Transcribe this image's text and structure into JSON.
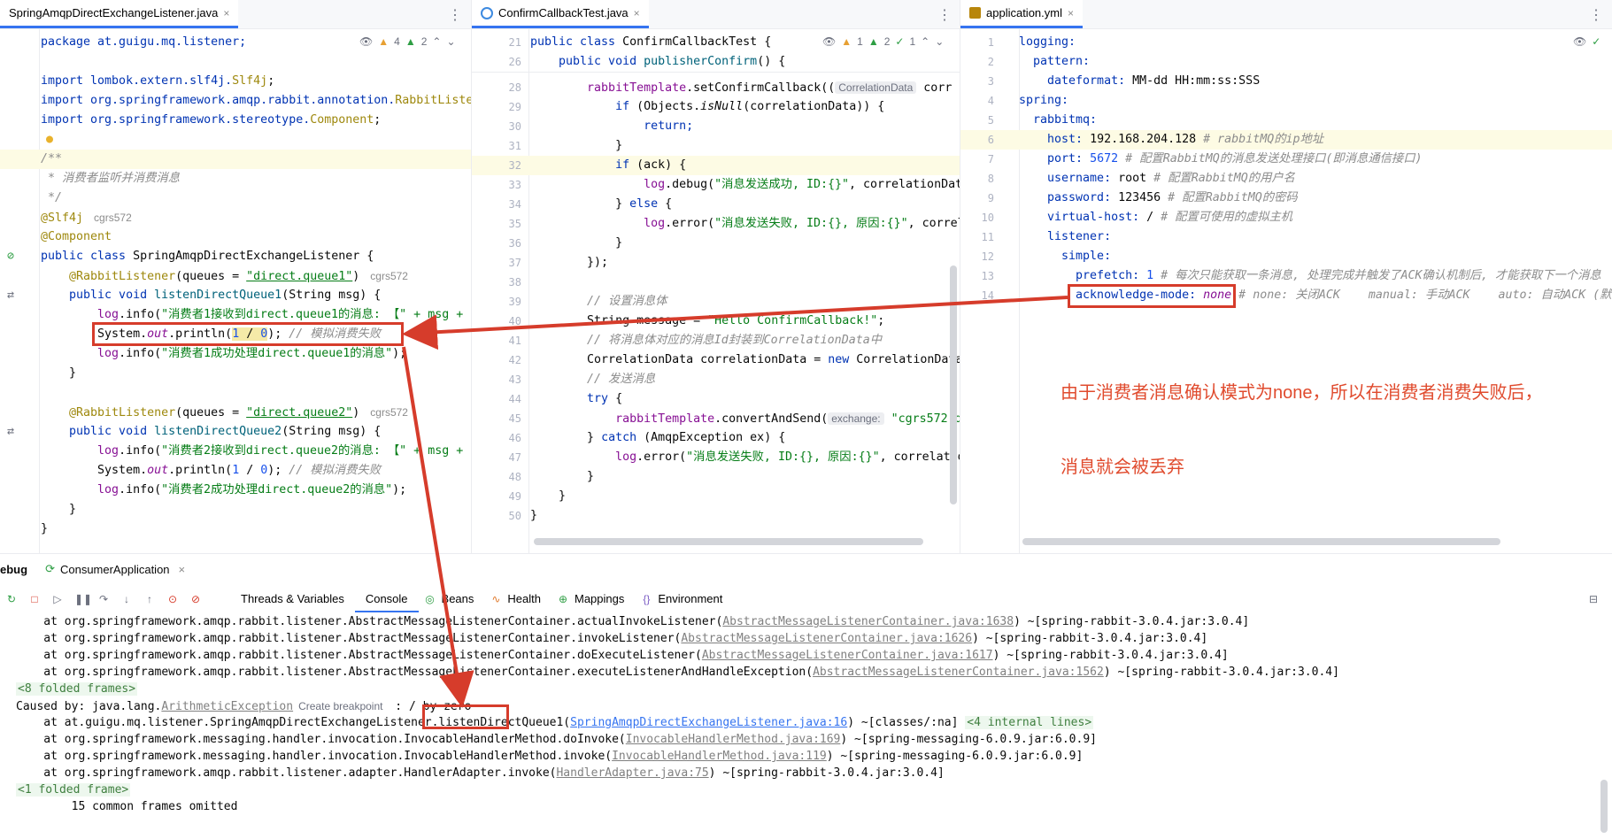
{
  "tabs": {
    "left": {
      "title": "SpringAmqpDirectExchangeListener.java",
      "close": "×"
    },
    "middle": {
      "title": "ConfirmCallbackTest.java",
      "close": "×"
    },
    "right": {
      "title": "application.yml",
      "close": "×"
    }
  },
  "inspections": {
    "left": {
      "warnings": "4",
      "typos": "2"
    },
    "middle": {
      "warnings": "1",
      "typos": "2",
      "ok": "1"
    }
  },
  "left_code": {
    "l1": "package at.guigu.mq.listener;",
    "l3a": "import lombok.extern.slf4j.",
    "l3b": "Slf4j",
    "l3c": ";",
    "l4a": "import org.springframework.amqp.rabbit.annotation.",
    "l4b": "RabbitListe",
    "l5a": "import org.springframework.stereotype.",
    "l5b": "Component",
    "l5c": ";",
    "c1": "/**",
    "c2": " * 消费者监听并消费消息",
    "c3": " */",
    "a1": "@Slf4j",
    "author": "cgrs572",
    "a2": "@Component",
    "cls_kw": "public class ",
    "cls_name": "SpringAmqpDirectExchangeListener",
    "cls_end": " {",
    "r1a": "    @RabbitListener",
    "r1b": "(queues = ",
    "r1c": "\"direct.queue1\"",
    "r1d": ")",
    "m1a": "    public void ",
    "m1b": "listenDirectQueue1",
    "m1c": "(String msg) {",
    "log1a": "        log",
    "log1b": ".info(",
    "log1c": "\"消费者1接收到direct.queue1的消息: 【\" + msg + \"",
    "p1a": "        System.",
    "p1b": "out",
    "p1c": ".println(",
    "p1d": "1",
    "p1e": " / ",
    "p1f": "0",
    "p1g": "); ",
    "p1h": "// 模拟消费失败",
    "log2a": "        log",
    "log2b": ".info(",
    "log2c": "\"消费者1成功处理direct.queue1的消息\"",
    "log2d": ");",
    "close1": "    }",
    "r2a": "    @RabbitListener",
    "r2b": "(queues = ",
    "r2c": "\"direct.queue2\"",
    "r2d": ")",
    "m2a": "    public void ",
    "m2b": "listenDirectQueue2",
    "m2c": "(String msg) {",
    "log3a": "        log",
    "log3b": ".info(",
    "log3c": "\"消费者2接收到direct.queue2的消息: 【\" + msg + \"",
    "p2a": "        System.",
    "p2b": "out",
    "p2c": ".println(",
    "p2d": "1",
    "p2e": " / ",
    "p2f": "0",
    "p2g": "); ",
    "p2h": "// 模拟消费失败",
    "log4a": "        log",
    "log4b": ".info(",
    "log4c": "\"消费者2成功处理direct.queue2的消息\"",
    "log4d": ");",
    "close2": "    }",
    "close3": "}"
  },
  "middle_code": {
    "lines": [
      "21",
      "26",
      "28",
      "29",
      "30",
      "31",
      "32",
      "33",
      "34",
      "35",
      "36",
      "37",
      "38",
      "39",
      "40",
      "41",
      "42",
      "43",
      "44",
      "45",
      "46",
      "47",
      "48",
      "49",
      "50"
    ],
    "c21a": "public class ",
    "c21b": "ConfirmCallbackTest",
    "c21c": " {",
    "c26a": "    public void ",
    "c26b": "publisherConfirm",
    "c26c": "() {",
    "c28a": "        rabbitTemplate",
    "c28b": ".setConfirmCallback((",
    "c28hint": "CorrelationData",
    "c28c": " corr",
    "c29a": "            if ",
    "c29b": "(Objects.",
    "c29c": "isNull",
    "c29d": "(correlationData)) {",
    "c30": "                return;",
    "c31": "            }",
    "c32a": "            if ",
    "c32b": "(ack) {",
    "c33a": "                log",
    "c33b": ".debug(",
    "c33c": "\"消息发送成功, ID:{}\"",
    "c33d": ", correlationDat",
    "c34a": "            } ",
    "c34b": "else",
    "c34c": " {",
    "c35a": "                log",
    "c35b": ".error(",
    "c35c": "\"消息发送失败, ID:{}, 原因:{}\"",
    "c35d": ", correl",
    "c36": "            }",
    "c37": "        });",
    "c39": "        // 设置消息体",
    "c40a": "        String message = ",
    "c40b": "\"Hello ConfirmCallback!\"",
    "c40c": ";",
    "c41": "        // 将消息体对应的消息Id封装到CorrelationData中",
    "c42a": "        CorrelationData correlationData = ",
    "c42b": "new",
    "c42c": " CorrelationData",
    "c43": "        // 发送消息",
    "c44a": "        try",
    "c44b": " {",
    "c45a": "            rabbitTemplate",
    "c45b": ".convertAndSend(",
    "c45hint": "exchange:",
    "c45c": " \"cgrs572.d",
    "c46a": "        } ",
    "c46b": "catch",
    "c46c": " (AmqpException ex) {",
    "c47a": "            log",
    "c47b": ".error(",
    "c47c": "\"消息发送失败, ID:{}, 原因:{}\"",
    "c47d": ", correlatio",
    "c48": "        }",
    "c49": "    }",
    "c50": "}"
  },
  "right_code": {
    "lines": [
      "1",
      "2",
      "3",
      "4",
      "5",
      "6",
      "7",
      "8",
      "9",
      "10",
      "11",
      "12",
      "13",
      "14"
    ],
    "y1": "logging:",
    "y2": "  pattern:",
    "y3k": "    dateformat:",
    "y3v": " MM-dd HH:mm:ss:SSS",
    "y4": "spring:",
    "y5": "  rabbitmq:",
    "y6k": "    host:",
    "y6v": " 192.168.204.128 ",
    "y6c": "# rabbitMQ的ip地址",
    "y7k": "    port:",
    "y7v": " 5672 ",
    "y7c": "# 配置RabbitMQ的消息发送处理接口(即消息通信接口)",
    "y8k": "    username:",
    "y8v": " root ",
    "y8c": "# 配置RabbitMQ的用户名",
    "y9k": "    password:",
    "y9v": " 123456 ",
    "y9c": "# 配置RabbitMQ的密码",
    "y10k": "    virtual-host:",
    "y10v": " / ",
    "y10c": "# 配置可使用的虚拟主机",
    "y11": "    listener:",
    "y12": "      simple:",
    "y13k": "        prefetch:",
    "y13v": " 1 ",
    "y13c": "# 每次只能获取一条消息, 处理完成并触发了ACK确认机制后, 才能获取下一个消息",
    "y14k": "        acknowledge-mode:",
    "y14v": " none",
    "y14c": " # none: 关闭ACK    manual: 手动ACK    auto: 自动ACK (默认)"
  },
  "debug": {
    "title": "ebug",
    "run_config": "ConsumerApplication",
    "close": "×",
    "subtabs": [
      "Threads & Variables",
      "Console",
      "Beans",
      "Health",
      "Mappings",
      "Environment"
    ]
  },
  "console": {
    "s1a": "    at org.springframework.amqp.rabbit.listener.AbstractMessageListenerContainer.actualInvokeListener(",
    "s1b": "AbstractMessageListenerContainer.java:1638",
    "s1c": ") ~[spring-rabbit-3.0.4.jar:3.0.4]",
    "s2a": "    at org.springframework.amqp.rabbit.listener.AbstractMessageListenerContainer.invokeListener(",
    "s2b": "AbstractMessageListenerContainer.java:1626",
    "s2c": ") ~[spring-rabbit-3.0.4.jar:3.0.4]",
    "s3a": "    at org.springframework.amqp.rabbit.listener.AbstractMessageListenerContainer.doExecuteListener(",
    "s3b": "AbstractMessageListenerContainer.java:1617",
    "s3c": ") ~[spring-rabbit-3.0.4.jar:3.0.4]",
    "s4a": "    at org.springframework.amqp.rabbit.listener.AbstractMessageListenerContainer.executeListenerAndHandleException(",
    "s4b": "AbstractMessageListenerContainer.java:1562",
    "s4c": ") ~[spring-rabbit-3.0.4.jar:3.0.4]",
    "fold1": "<8 folded frames>",
    "cause_a": "Caused by: java.lang.",
    "cause_b": "ArithmeticException",
    "cause_bp": "Create breakpoint",
    "cause_c": " : ",
    "cause_d": "/ by zero",
    "s5a": "    at at.guigu.mq.listener.SpringAmqpDirectExchangeListener.listenDirectQueue1(",
    "s5b": "SpringAmqpDirectExchangeListener.java:16",
    "s5c": ") ~[classes/:na] ",
    "s5d": "<4 internal lines>",
    "s6a": "    at org.springframework.messaging.handler.invocation.InvocableHandlerMethod.doInvoke(",
    "s6b": "InvocableHandlerMethod.java:169",
    "s6c": ") ~[spring-messaging-6.0.9.jar:6.0.9]",
    "s7a": "    at org.springframework.messaging.handler.invocation.InvocableHandlerMethod.invoke(",
    "s7b": "InvocableHandlerMethod.java:119",
    "s7c": ") ~[spring-messaging-6.0.9.jar:6.0.9]",
    "s8a": "    at org.springframework.amqp.rabbit.listener.adapter.HandlerAdapter.invoke(",
    "s8b": "HandlerAdapter.java:75",
    "s8c": ") ~[spring-rabbit-3.0.4.jar:3.0.4]",
    "fold2": "<1 folded frame>",
    "s9": "        15 common frames omitted"
  },
  "annotation": {
    "note_line1": "由于消费者消息确认模式为none，所以在消费者消费失败后，",
    "note_line2": "消息就会被丢弃"
  },
  "colors": {
    "accent": "#3574f0",
    "annotation_red": "#d63c2b"
  }
}
